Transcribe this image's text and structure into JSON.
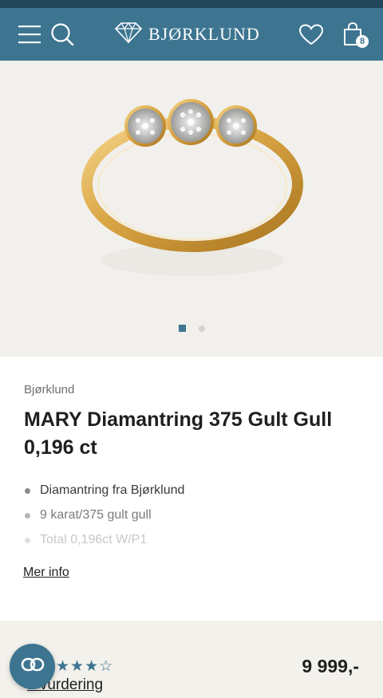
{
  "header": {
    "menu_icon": "hamburger-menu-icon",
    "search_icon": "search-icon",
    "logo_text": "BJØRKLUND",
    "wishlist_icon": "heart-icon",
    "cart_icon": "shopping-bag-icon",
    "cart_count": "8"
  },
  "gallery": {
    "image": "gold-ring-with-three-diamond-clusters",
    "slide_count": 2,
    "active_slide": 1
  },
  "product": {
    "brand": "Bjørklund",
    "title": "MARY Diamantring 375 Gult Gull 0,196 ct",
    "features": [
      "Diamantring fra Bjørklund",
      "9 karat/375 gult gull",
      "Total 0,196ct W/P1"
    ],
    "more_info_label": "Mer info"
  },
  "bottom": {
    "stars": "★★★☆",
    "rating_label": "1 vurdering",
    "price": "9 999,-",
    "fab_icon": "chat-link-icon"
  },
  "colors": {
    "brand_blue": "#3d7591",
    "status_bar": "#23475a",
    "gallery_bg": "#f2f0ec"
  }
}
